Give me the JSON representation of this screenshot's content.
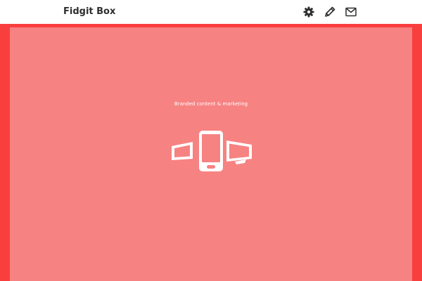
{
  "header": {
    "brand": "Fidgit Box",
    "icons": [
      "gear-icon",
      "pencil-icon",
      "mail-icon"
    ]
  },
  "hero": {
    "tagline": "Branded content & marketing",
    "illustration": "devices-icon"
  },
  "colors": {
    "header_bg": "#ffffff",
    "brand_text": "#2e2e2e",
    "frame_red": "#f93e3e",
    "hero_bg": "#f78282",
    "hero_text": "#ffffff"
  }
}
